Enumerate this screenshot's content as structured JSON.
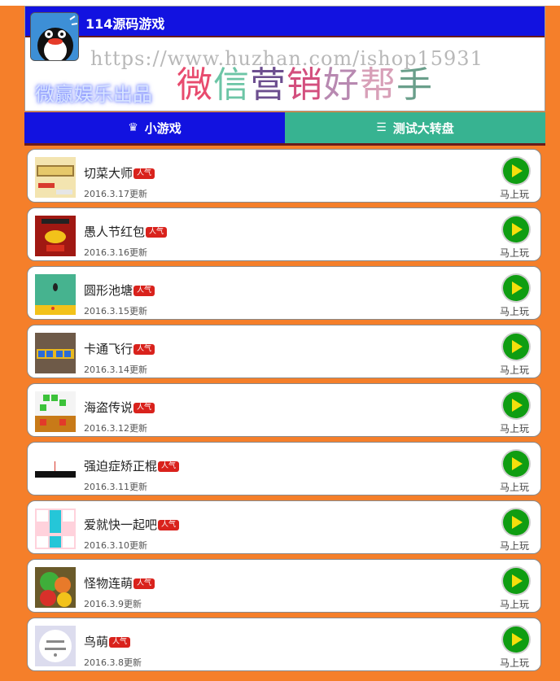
{
  "header": {
    "site_title": "114源码游戏",
    "watermark": "https://www.huzhan.com/ishop15931",
    "slogan_left": "微赢娱乐出品",
    "slogan_right": [
      "微",
      "信",
      "营",
      "销",
      "好",
      "帮",
      "手"
    ],
    "title_bar_color": "#1212e0"
  },
  "tabs": [
    {
      "label": "小游戏",
      "icon": "crown-icon",
      "color": "#1212e0"
    },
    {
      "label": "测试大转盘",
      "icon": "list-icon",
      "color": "#37b391"
    }
  ],
  "games": [
    {
      "name": "切菜大师",
      "badge": "人气",
      "date": "2016.3.17更新",
      "play": "马上玩"
    },
    {
      "name": "愚人节红包",
      "badge": "人气",
      "date": "2016.3.16更新",
      "play": "马上玩"
    },
    {
      "name": "圆形池塘",
      "badge": "人气",
      "date": "2016.3.15更新",
      "play": "马上玩"
    },
    {
      "name": "卡通飞行",
      "badge": "人气",
      "date": "2016.3.14更新",
      "play": "马上玩"
    },
    {
      "name": "海盗传说",
      "badge": "人气",
      "date": "2016.3.12更新",
      "play": "马上玩"
    },
    {
      "name": "强迫症矫正棍",
      "badge": "人气",
      "date": "2016.3.11更新",
      "play": "马上玩"
    },
    {
      "name": "爱就快一起吧",
      "badge": "人气",
      "date": "2016.3.10更新",
      "play": "马上玩"
    },
    {
      "name": "怪物连萌",
      "badge": "人气",
      "date": "2016.3.9更新",
      "play": "马上玩"
    },
    {
      "name": "鸟萌",
      "badge": "人气",
      "date": "2016.3.8更新",
      "play": "马上玩"
    }
  ],
  "colors": {
    "background": "#f57f2a",
    "play_button": "#0f9d12",
    "badge": "#d9221c"
  }
}
